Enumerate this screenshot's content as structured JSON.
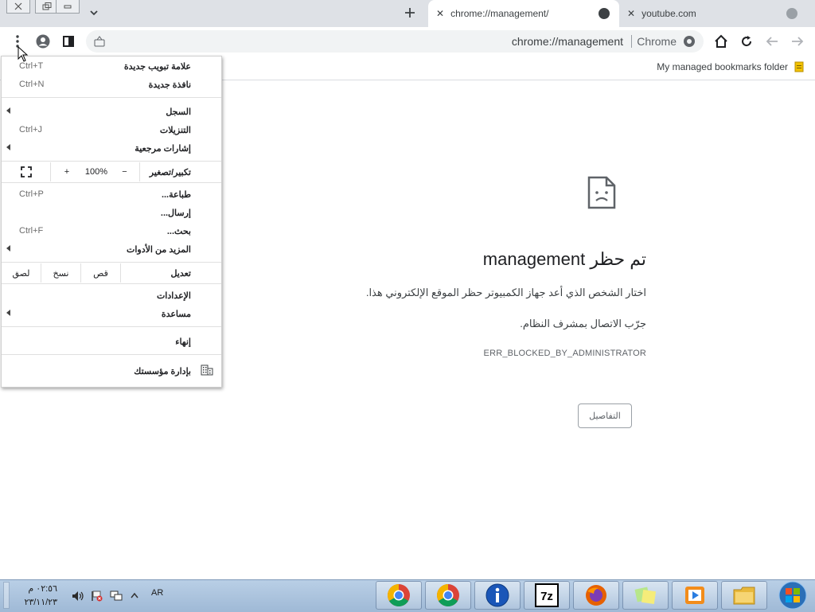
{
  "tabs": [
    {
      "title": "chrome://management/",
      "active": true
    },
    {
      "title": "youtube.com",
      "active": false
    }
  ],
  "toolbar": {
    "url": "chrome://management",
    "site_label": "Chrome"
  },
  "bookmarks": {
    "folder_label": "My managed bookmarks folder"
  },
  "error_page": {
    "title": "تم حظر management",
    "message": "اختار الشخص الذي أعد جهاز الكمبيوتر حظر الموقع الإلكتروني هذا.",
    "hint": "جرّب الاتصال بمشرف النظام.",
    "code": "ERR_BLOCKED_BY_ADMINISTRATOR",
    "details_button": "التفاصيل"
  },
  "menu": {
    "new_tab": {
      "label": "علامة تبويب جديدة",
      "shortcut": "Ctrl+T"
    },
    "new_window": {
      "label": "نافذة جديدة",
      "shortcut": "Ctrl+N"
    },
    "history": {
      "label": "السجل"
    },
    "downloads": {
      "label": "التنزيلات",
      "shortcut": "Ctrl+J"
    },
    "bookmarks": {
      "label": "إشارات مرجعية"
    },
    "zoom": {
      "label": "تكبير/تصغير",
      "minus": "−",
      "value": "100%",
      "plus": "+"
    },
    "print": {
      "label": "طباعة...",
      "shortcut": "Ctrl+P"
    },
    "cast": {
      "label": "إرسال..."
    },
    "find": {
      "label": "بحث...",
      "shortcut": "Ctrl+F"
    },
    "more_tools": {
      "label": "المزيد من الأدوات"
    },
    "edit": {
      "label": "تعديل",
      "cut": "قص",
      "copy": "نسخ",
      "paste": "لصق"
    },
    "settings": {
      "label": "الإعدادات"
    },
    "help": {
      "label": "مساعدة"
    },
    "exit": {
      "label": "إنهاء"
    },
    "managed": {
      "label": "بإدارة مؤسستك"
    }
  },
  "taskbar": {
    "lang": "AR",
    "time": "٠٢:٥٦ م",
    "date": "٢٣/١١/٢٣"
  }
}
